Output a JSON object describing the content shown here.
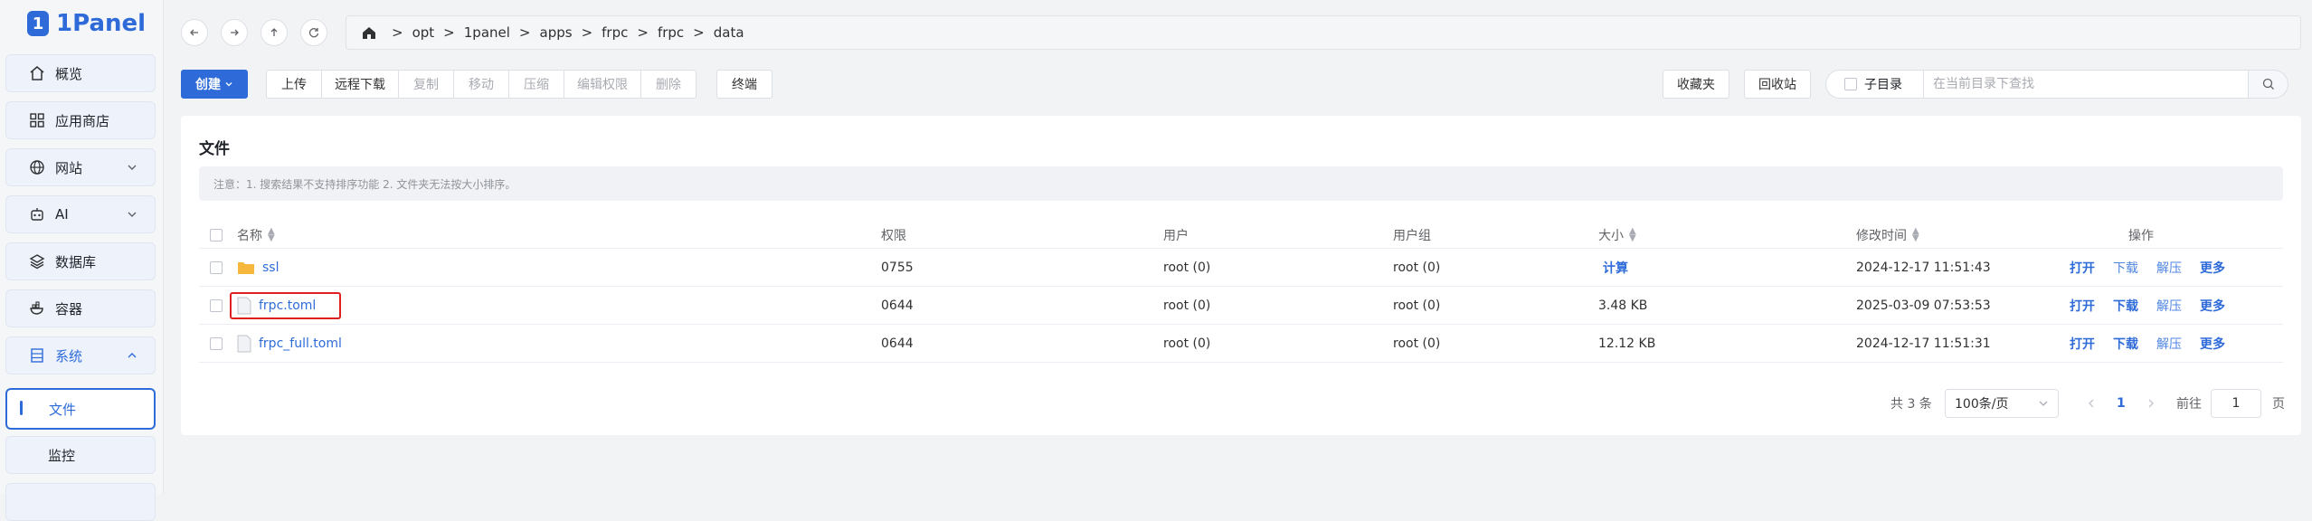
{
  "app": {
    "logo_text": "1Panel"
  },
  "sidebar": {
    "items": [
      {
        "label": "概览",
        "icon": "home-icon"
      },
      {
        "label": "应用商店",
        "icon": "grid-icon"
      },
      {
        "label": "网站",
        "icon": "globe-icon",
        "expandable": true
      },
      {
        "label": "AI",
        "icon": "robot-icon",
        "expandable": true
      },
      {
        "label": "数据库",
        "icon": "layers-icon"
      },
      {
        "label": "容器",
        "icon": "container-icon"
      },
      {
        "label": "系统",
        "icon": "server-icon",
        "expanded": true
      },
      {
        "label": "文件",
        "active": true
      },
      {
        "label": "监控"
      }
    ]
  },
  "breadcrumb": {
    "parts": [
      "opt",
      "1panel",
      "apps",
      "frpc",
      "frpc",
      "data"
    ]
  },
  "toolbar": {
    "create": "创建",
    "upload": "上传",
    "remote_download": "远程下载",
    "copy": "复制",
    "move": "移动",
    "compress": "压缩",
    "edit_permission": "编辑权限",
    "delete": "删除",
    "terminal": "终端",
    "favorites": "收藏夹",
    "recycle_bin": "回收站",
    "subdir_label": "子目录",
    "search_placeholder": "在当前目录下查找"
  },
  "card": {
    "title": "文件",
    "notice": "注意：1. 搜索结果不支持排序功能 2. 文件夹无法按大小排序。"
  },
  "table": {
    "headers": {
      "name": "名称",
      "permission": "权限",
      "user": "用户",
      "group": "用户组",
      "size": "大小",
      "modified": "修改时间",
      "actions": "操作"
    },
    "rows": [
      {
        "name": "ssl",
        "type": "folder",
        "permission": "0755",
        "user": "root (0)",
        "group": "root (0)",
        "size": "计算",
        "modified": "2024-12-17 11:51:43"
      },
      {
        "name": "frpc.toml",
        "type": "file",
        "permission": "0644",
        "user": "root (0)",
        "group": "root (0)",
        "size": "3.48 KB",
        "modified": "2025-03-09 07:53:53",
        "highlighted": true
      },
      {
        "name": "frpc_full.toml",
        "type": "file",
        "permission": "0644",
        "user": "root (0)",
        "group": "root (0)",
        "size": "12.12 KB",
        "modified": "2024-12-17 11:51:31"
      }
    ],
    "row_actions": {
      "open": "打开",
      "download": "下载",
      "decompress": "解压",
      "more": "更多"
    }
  },
  "pagination": {
    "total": "共 3 条",
    "page_size": "100条/页",
    "current": "1",
    "goto_label": "前往",
    "goto_value": "1",
    "page_suffix": "页"
  },
  "colors": {
    "accent": "#2e6bd9",
    "highlight_border": "#e02020"
  }
}
